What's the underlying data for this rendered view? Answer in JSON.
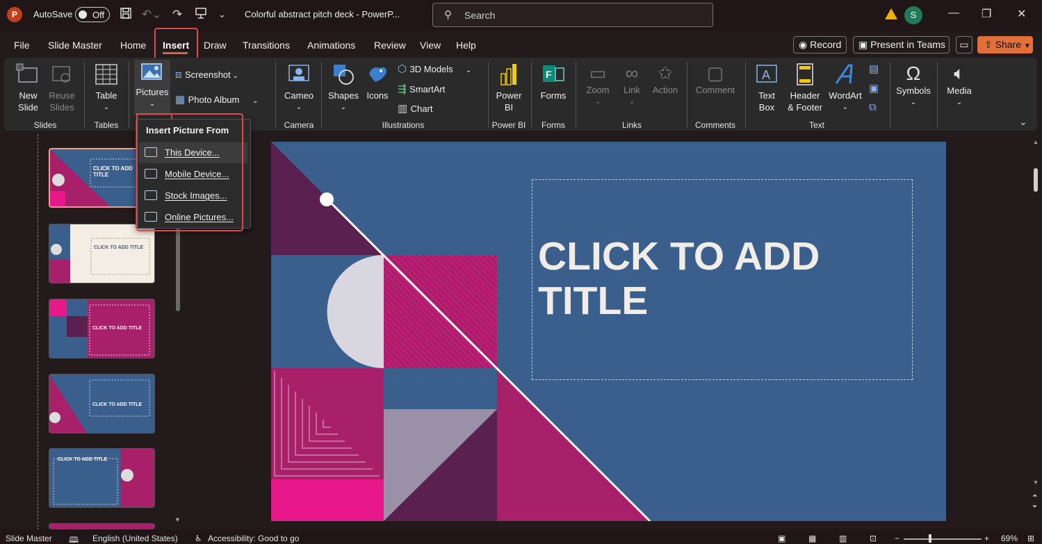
{
  "titlebar": {
    "app_logo": "P",
    "autosave_label": "AutoSave",
    "autosave_state": "Off",
    "doc_title": "Colorful abstract pitch deck - PowerP...",
    "search_placeholder": "Search",
    "user_initial": "S"
  },
  "menu": {
    "items": [
      "File",
      "Slide Master",
      "Home",
      "Insert",
      "Draw",
      "Transitions",
      "Animations",
      "Review",
      "View",
      "Help"
    ],
    "active": "Insert",
    "record": "Record",
    "present": "Present in Teams",
    "share": "Share"
  },
  "ribbon": {
    "slides": {
      "new_slide_1": "New",
      "new_slide_2": "Slide",
      "reuse_1": "Reuse",
      "reuse_2": "Slides",
      "label": "Slides"
    },
    "tables": {
      "table": "Table",
      "label": "Tables"
    },
    "images": {
      "pictures": "Pictures",
      "screenshot": "Screenshot",
      "photo_album": "Photo Album"
    },
    "camera": {
      "cameo": "Cameo",
      "label": "Camera"
    },
    "illustrations": {
      "shapes": "Shapes",
      "icons": "Icons",
      "models": "3D Models",
      "smartart": "SmartArt",
      "chart": "Chart",
      "label": "Illustrations"
    },
    "powerbi": {
      "line1": "Power",
      "line2": "BI",
      "label": "Power BI"
    },
    "forms": {
      "forms": "Forms",
      "label": "Forms"
    },
    "links": {
      "zoom": "Zoom",
      "link": "Link",
      "action": "Action",
      "label": "Links"
    },
    "comments": {
      "comment": "Comment",
      "label": "Comments"
    },
    "text": {
      "textbox_1": "Text",
      "textbox_2": "Box",
      "header_1": "Header",
      "header_2": "& Footer",
      "wordart": "WordArt",
      "label": "Text"
    },
    "symbols": {
      "symbols": "Symbols"
    },
    "media": {
      "media": "Media"
    }
  },
  "dropdown": {
    "heading": "Insert Picture From",
    "items": [
      "This Device...",
      "Mobile Device...",
      "Stock Images...",
      "Online Pictures..."
    ]
  },
  "thumbnails": {
    "t1": "CLICK TO ADD TITLE",
    "t2": "CLICK TO ADD TITLE",
    "t3": "CLICK TO ADD TITLE",
    "t4": "CLICK TO ADD TITLE",
    "t5": "CLICK TO ADD TITLE"
  },
  "slide": {
    "title_line1": "CLICK TO ADD",
    "title_line2": "TITLE"
  },
  "status": {
    "view": "Slide Master",
    "language": "English (United States)",
    "accessibility": "Accessibility: Good to go",
    "zoom": "69%"
  },
  "colors": {
    "accent": "#e2603a",
    "slide_bg": "#3a5f8c",
    "magenta": "#a8206a",
    "pink": "#e8178a",
    "plum": "#5a2050",
    "highlight": "#e04a4a"
  }
}
